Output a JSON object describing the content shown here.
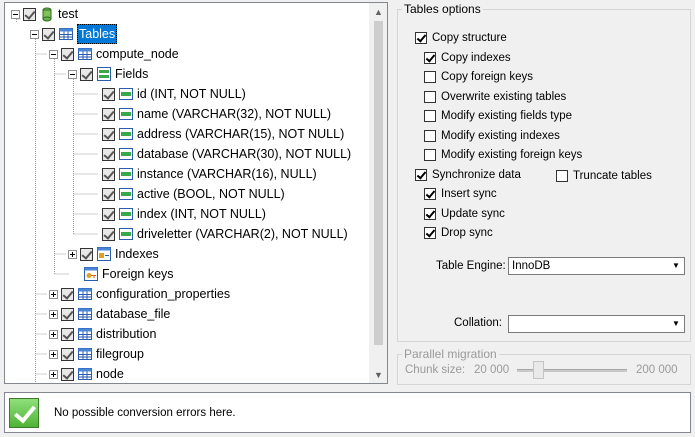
{
  "tree": {
    "root": {
      "label": "test"
    },
    "tables": {
      "label": "Tables"
    },
    "compute_node": {
      "label": "compute_node"
    },
    "fields": {
      "label": "Fields"
    },
    "field_items": [
      "id (INT, NOT NULL)",
      "name (VARCHAR(32), NOT NULL)",
      "address (VARCHAR(15), NOT NULL)",
      "database (VARCHAR(30), NOT NULL)",
      "instance (VARCHAR(16), NULL)",
      "active (BOOL, NOT NULL)",
      "index (INT, NOT NULL)",
      "driveletter (VARCHAR(2), NOT NULL)"
    ],
    "indexes": {
      "label": "Indexes"
    },
    "foreign_keys": {
      "label": "Foreign keys"
    },
    "other_tables": [
      "configuration_properties",
      "database_file",
      "distribution",
      "filegroup",
      "node"
    ]
  },
  "options": {
    "legend": "Tables options",
    "copy_structure": "Copy structure",
    "copy_indexes": "Copy indexes",
    "copy_foreign_keys": "Copy foreign keys",
    "overwrite_tables": "Overwrite existing tables",
    "modify_fields_type": "Modify existing fields type",
    "modify_indexes": "Modify existing indexes",
    "modify_foreign_keys": "Modify existing foreign keys",
    "synchronize_data": "Synchronize data",
    "truncate_tables": "Truncate tables",
    "insert_sync": "Insert sync",
    "update_sync": "Update sync",
    "drop_sync": "Drop sync",
    "table_engine_label": "Table Engine:",
    "table_engine_value": "InnoDB",
    "collation_label": "Collation:",
    "collation_value": ""
  },
  "parallel": {
    "legend": "Parallel migration",
    "chunk_label": "Chunk size:",
    "min": "20 000",
    "max": "200 000"
  },
  "status": {
    "message": "No possible conversion errors here."
  }
}
